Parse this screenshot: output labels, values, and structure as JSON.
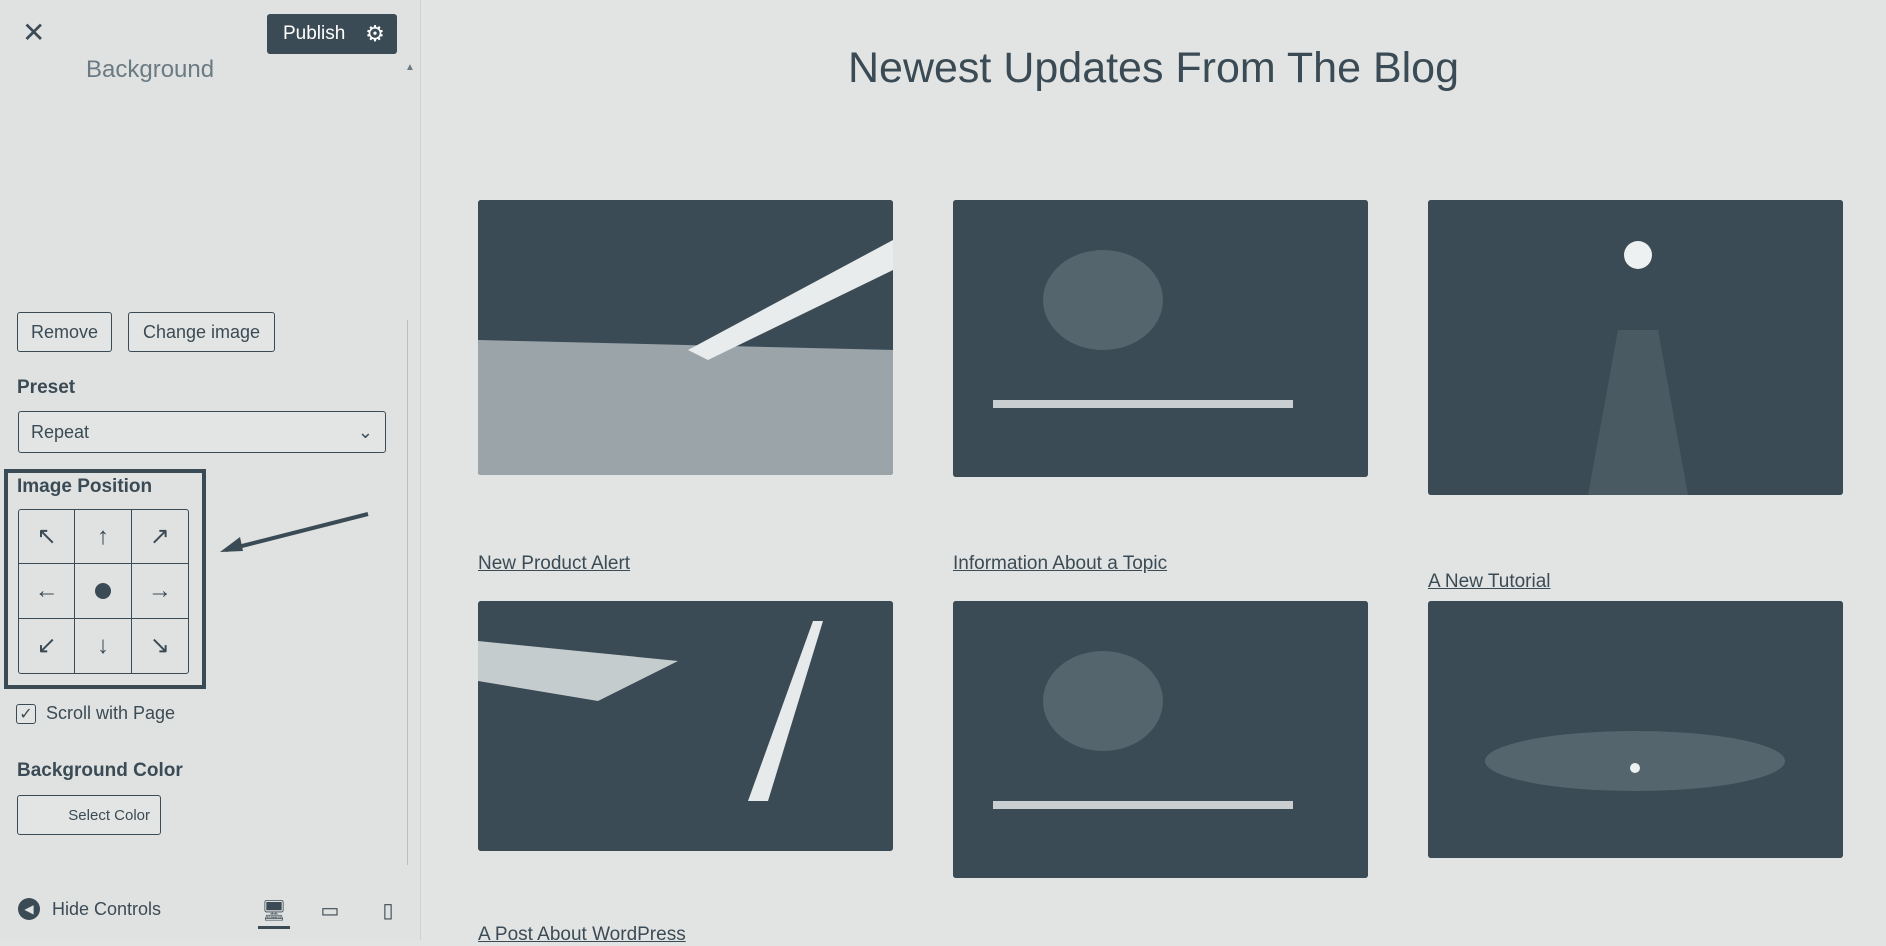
{
  "panel": {
    "close_label": "✕",
    "publish_label": "Publish",
    "section_title": "Background",
    "remove_label": "Remove",
    "change_image_label": "Change image",
    "preset_label": "Preset",
    "preset_value": "Repeat",
    "image_position_label": "Image Position",
    "position_grid": [
      "↖",
      "↑",
      "↗",
      "←",
      "",
      "→",
      "↙",
      "↓",
      "↘"
    ],
    "scroll_label": "Scroll with Page",
    "scroll_checked": true,
    "bg_color_label": "Background Color",
    "select_color_label": "Select Color",
    "hide_controls_label": "Hide Controls"
  },
  "preview": {
    "title": "Newest Updates From The Blog",
    "posts": [
      {
        "title": "New Product Alert"
      },
      {
        "title": "Information About a Topic"
      },
      {
        "title": "A New Tutorial"
      },
      {
        "title": "A Post About WordPress"
      },
      {
        "title": ""
      },
      {
        "title": ""
      }
    ]
  },
  "colors": {
    "accent": "#3b4b55",
    "background": "#e2e4e3"
  }
}
